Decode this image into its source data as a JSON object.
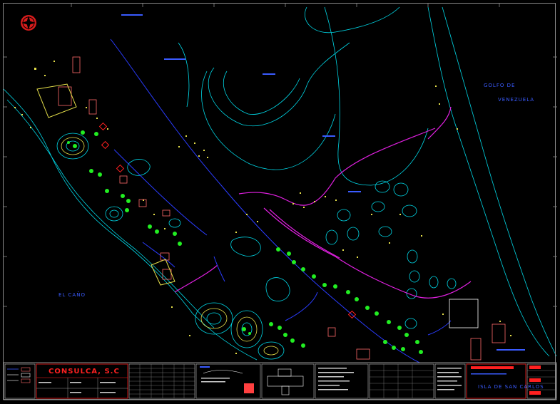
{
  "labels": {
    "gulf_line1": "GOLFO DE",
    "gulf_line2": "VENEZUELA",
    "cano": "EL   CAÑO"
  },
  "title_block": {
    "company": "CONSULCA, S.C",
    "project": "ISLA DE SAN CARLOS"
  },
  "colors": {
    "background": "#000000",
    "contour": "#00d7e6",
    "road": "#e020e0",
    "vegetation": "#22ee22",
    "sand": "#e6e04a",
    "blue_line": "#2a3cff",
    "building": "#ff6a6a",
    "frame": "#8a8a8a",
    "company": "#ff2020"
  },
  "icons": {
    "north": "north-arrow-icon"
  }
}
